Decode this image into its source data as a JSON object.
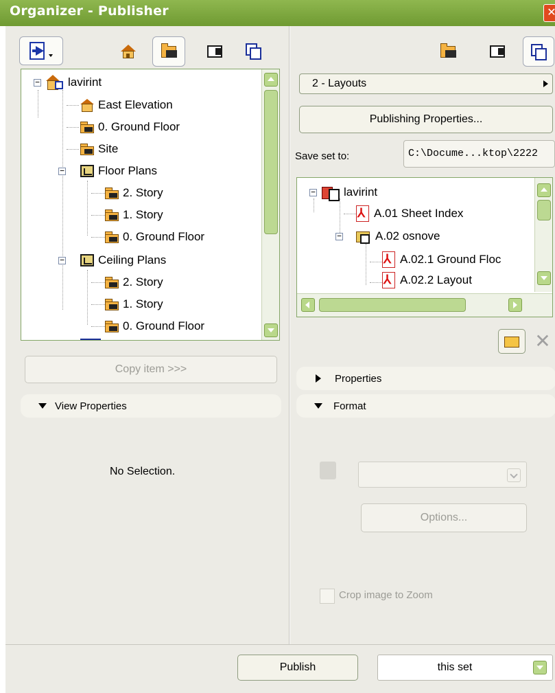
{
  "window": {
    "title": "Organizer - Publisher",
    "close_glyph": "✕"
  },
  "left_panel": {
    "toolbar_icons": [
      "export-icon",
      "project-map-icon",
      "view-map-icon",
      "layout-book-icon",
      "publisher-sets-icon"
    ],
    "tree": [
      {
        "label": "lavirint",
        "icon": "project-icon",
        "expander": "−"
      },
      {
        "label": "East Elevation",
        "icon": "elevation-icon"
      },
      {
        "label": "0. Ground Floor",
        "icon": "view-folder-icon"
      },
      {
        "label": "Site",
        "icon": "view-folder-icon"
      },
      {
        "label": "Floor Plans",
        "icon": "floor-plan-icon",
        "expander": "−"
      },
      {
        "label": "2. Story",
        "icon": "view-folder-icon"
      },
      {
        "label": "1. Story",
        "icon": "view-folder-icon"
      },
      {
        "label": "0. Ground Floor",
        "icon": "view-folder-icon"
      },
      {
        "label": "Ceiling Plans",
        "icon": "ceiling-plan-icon",
        "expander": "−"
      },
      {
        "label": "2. Story",
        "icon": "view-folder-icon"
      },
      {
        "label": "1. Story",
        "icon": "view-folder-icon"
      },
      {
        "label": "0. Ground Floor",
        "icon": "view-folder-icon"
      }
    ],
    "copy_button": "Copy item >>>",
    "view_properties": "View Properties",
    "no_selection": "No Selection."
  },
  "right_panel": {
    "toolbar_icons": [
      "view-map-icon",
      "layout-book-icon",
      "publisher-sets-icon"
    ],
    "set_selector": "2 - Layouts",
    "publishing_properties_button": "Publishing Properties...",
    "save_set_label": "Save set to:",
    "save_set_path": "C:\\Docume...ktop\\2222",
    "tree": [
      {
        "label": "lavirint",
        "icon": "layout-root-icon",
        "expander": "−"
      },
      {
        "label": "A.01 Sheet Index",
        "icon": "pdf-icon"
      },
      {
        "label": "A.02 osnove",
        "icon": "layout-folder-icon",
        "expander": "−"
      },
      {
        "label": "A.02.1 Ground Floc",
        "icon": "pdf-icon"
      },
      {
        "label": "A.02.2 Layout",
        "icon": "pdf-icon"
      }
    ],
    "properties_section": "Properties",
    "format_section": "Format",
    "options_button": "Options...",
    "crop_label": "Crop image to Zoom"
  },
  "footer": {
    "publish_button": "Publish",
    "publish_scope": "this set"
  },
  "colors": {
    "title_bar": "#7ba63c",
    "tree_border": "#84a667",
    "panel_bg": "#ecebe5"
  }
}
